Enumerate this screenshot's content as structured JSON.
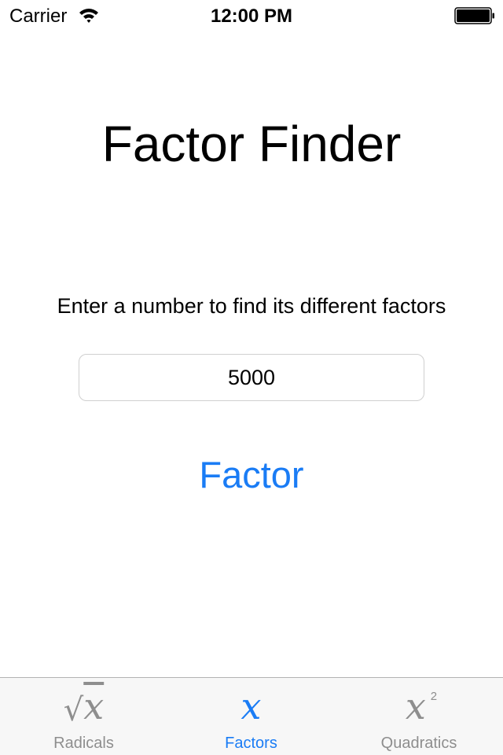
{
  "status_bar": {
    "carrier": "Carrier",
    "time": "12:00 PM",
    "wifi_icon": "wifi-icon",
    "battery_icon": "battery-full-icon",
    "battery_level": 1.0
  },
  "main": {
    "title": "Factor Finder",
    "instructions": "Enter a number to find its different factors",
    "number_input": {
      "value": "5000",
      "placeholder": ""
    },
    "factor_button_label": "Factor"
  },
  "tab_bar": {
    "accent_color": "#1a7cf5",
    "inactive_color": "#8e8e8e",
    "tabs": [
      {
        "label": "Radicals",
        "icon": "square-root-x-icon",
        "icon_text": "√",
        "icon_var": "x",
        "active": false
      },
      {
        "label": "Factors",
        "icon": "x-variable-icon",
        "icon_text": "x",
        "active": true
      },
      {
        "label": "Quadratics",
        "icon": "x-squared-icon",
        "icon_text": "x",
        "icon_sup": "2",
        "active": false
      }
    ]
  }
}
